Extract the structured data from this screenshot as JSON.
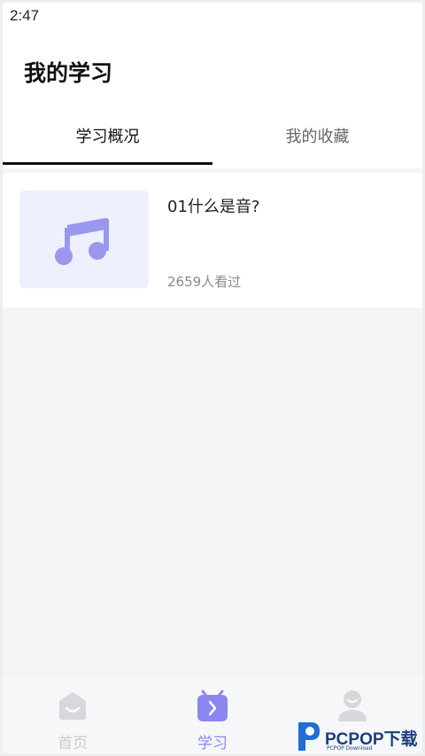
{
  "status_bar": {
    "time": "2:47"
  },
  "header": {
    "title": "我的学习"
  },
  "tabs": [
    {
      "label": "学习概况",
      "active": true
    },
    {
      "label": "我的收藏",
      "active": false
    }
  ],
  "course_list": [
    {
      "title": "01什么是音?",
      "views": "2659人看过",
      "thumbnail_icon": "music-note-icon"
    }
  ],
  "bottom_nav": [
    {
      "label": "首页",
      "icon": "home-icon",
      "active": false
    },
    {
      "label": "学习",
      "icon": "study-icon",
      "active": true
    },
    {
      "label": "",
      "icon": "profile-icon",
      "active": false
    }
  ],
  "watermark": {
    "text": "PCPOP下载",
    "subtext": "PCPOP Download"
  },
  "colors": {
    "accent": "#8b86f0",
    "thumb_bg": "#eff0fd",
    "inactive_icon": "#d6d8dc"
  }
}
